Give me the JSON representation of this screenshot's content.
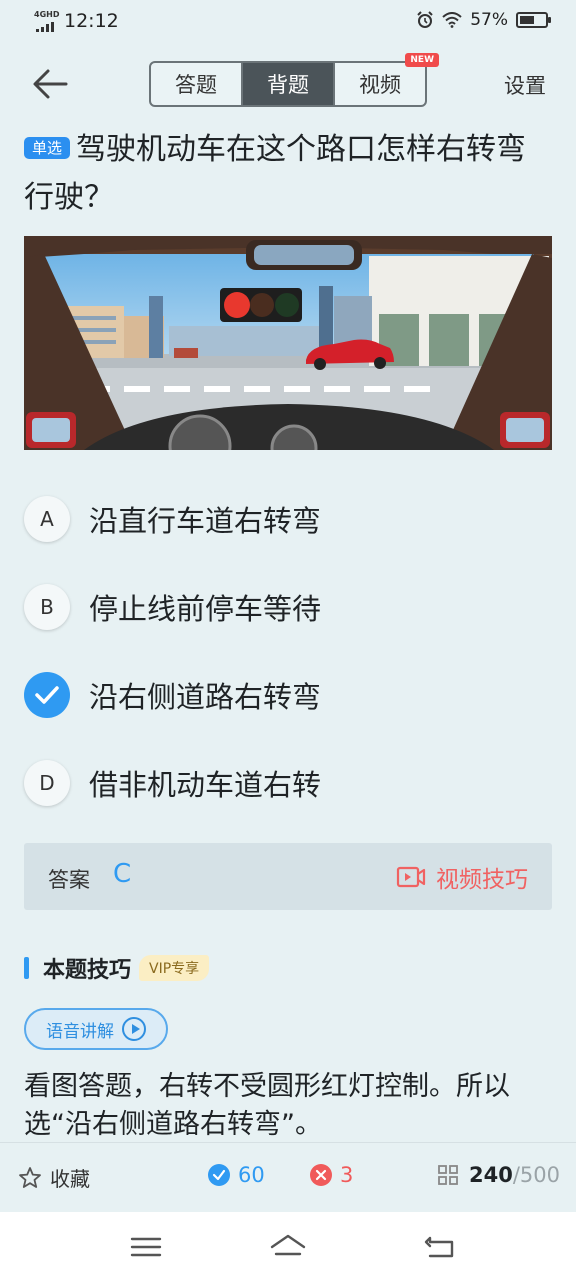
{
  "status": {
    "network_label": "4GHD",
    "time": "12:12",
    "battery": "57%"
  },
  "header": {
    "tabs": [
      {
        "label": "答题",
        "active": false
      },
      {
        "label": "背题",
        "active": true
      },
      {
        "label": "视频",
        "active": false,
        "badge": "NEW"
      }
    ],
    "settings_label": "设置"
  },
  "question": {
    "tag": "单选",
    "text": "驾驶机动车在这个路口怎样右转弯行驶？"
  },
  "options": [
    {
      "letter": "A",
      "text": "沿直行车道右转弯",
      "selected": false
    },
    {
      "letter": "B",
      "text": "停止线前停车等待",
      "selected": false
    },
    {
      "letter": "C",
      "text": "沿右侧道路右转弯",
      "selected": true
    },
    {
      "letter": "D",
      "text": "借非机动车道右转",
      "selected": false
    }
  ],
  "answer": {
    "label": "答案",
    "value": "C",
    "video_tip_label": "视频技巧"
  },
  "tips": {
    "title": "本题技巧",
    "vip_badge": "VIP专享",
    "voice_label": "语音讲解",
    "explanation": "看图答题，右转不受圆形红灯控制。所以选“沿右侧道路右转弯”。"
  },
  "bottom": {
    "favorite_label": "收藏",
    "correct_count": "60",
    "wrong_count": "3",
    "current": "240",
    "total": "/500"
  },
  "colors": {
    "accent": "#2f9af2",
    "wrong": "#f05a5a",
    "background": "#e7f1f3"
  }
}
